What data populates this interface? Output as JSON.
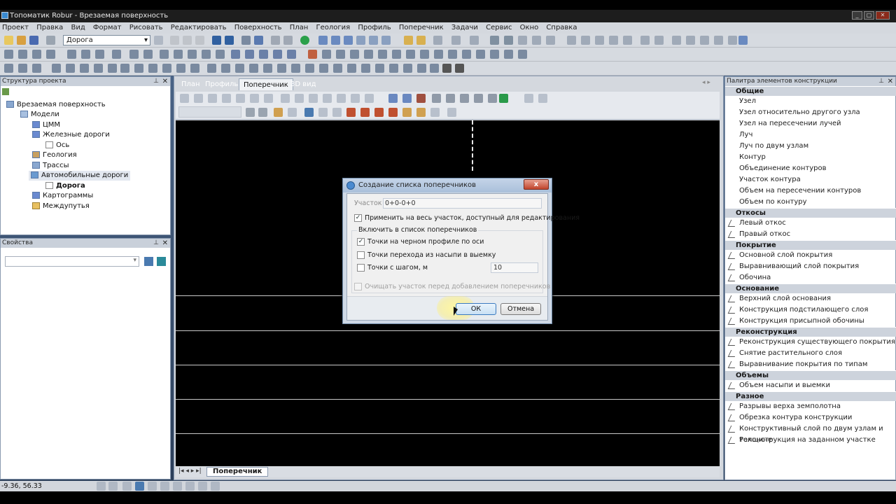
{
  "window": {
    "title": "Топоматик Robur - Врезаемая поверхность"
  },
  "menu": [
    "Проект",
    "Правка",
    "Вид",
    "Формат",
    "Рисовать",
    "Редактировать",
    "Поверхность",
    "План",
    "Геология",
    "Профиль",
    "Поперечник",
    "Задачи",
    "Сервис",
    "Окно",
    "Справка"
  ],
  "toolbar": {
    "road_combo": "Дорога"
  },
  "project_panel": {
    "title": "Структура проекта",
    "items": [
      {
        "label": "Врезаемая поверхность"
      },
      {
        "label": "Модели"
      },
      {
        "label": "ЦММ"
      },
      {
        "label": "Железные дороги"
      },
      {
        "label": "Ось"
      },
      {
        "label": "Геология"
      },
      {
        "label": "Трассы"
      },
      {
        "label": "Автомобильные дороги"
      },
      {
        "label": "Дорога"
      },
      {
        "label": "Картограммы"
      },
      {
        "label": "Междупутья"
      }
    ]
  },
  "properties_panel": {
    "title": "Свойства"
  },
  "doc_tabs": [
    "План",
    "Профиль",
    "Поперечник",
    "3D вид"
  ],
  "bottom_tab": "Поперечник",
  "status": {
    "coords": "-9.36, 56.33"
  },
  "palette": {
    "title": "Палитра элементов конструкции",
    "sections": [
      {
        "name": "Общие",
        "items": [
          "Узел",
          "Узел относительно другого узла",
          "Узел на пересечении лучей",
          "Луч",
          "Луч по двум узлам",
          "Контур",
          "Объединение контуров",
          "Участок контура",
          "Объем на пересечении контуров",
          "Объем по контуру"
        ]
      },
      {
        "name": "Откосы",
        "items": [
          "Левый откос",
          "Правый откос"
        ]
      },
      {
        "name": "Покрытие",
        "items": [
          "Основной слой покрытия",
          "Выравнивающий слой покрытия",
          "Обочина"
        ]
      },
      {
        "name": "Основание",
        "items": [
          "Верхний слой основания",
          "Конструкция подстилающего слоя",
          "Конструкция присыпной обочины"
        ]
      },
      {
        "name": "Реконструкция",
        "items": [
          "Реконструкция существующего покрытия",
          "Снятие растительного слоя",
          "Выравнивание покрытия по типам"
        ]
      },
      {
        "name": "Объемы",
        "items": [
          "Объем насыпи и выемки"
        ]
      },
      {
        "name": "Разное",
        "items": [
          "Разрывы верха земполотна",
          "Обрезка контура конструкции",
          "Конструктивный слой по двум узлам и толщине",
          "Реконструкция на заданном участке"
        ]
      }
    ]
  },
  "dialog": {
    "title": "Создание списка поперечников",
    "close": "x",
    "section_label": "Участок",
    "section_value": "0+0-0+0",
    "apply_all": "Применить на весь участок, доступный для редактирования",
    "include_group": "Включить в список поперечников",
    "opt1": "Точки на черном профиле по оси",
    "opt2": "Точки перехода из насыпи в выемку",
    "opt3": "Точки с шагом, м",
    "step_value": "10",
    "clear_label": "Очищать участок перед добавлением поперечников",
    "ok": "ОК",
    "cancel": "Отмена"
  }
}
